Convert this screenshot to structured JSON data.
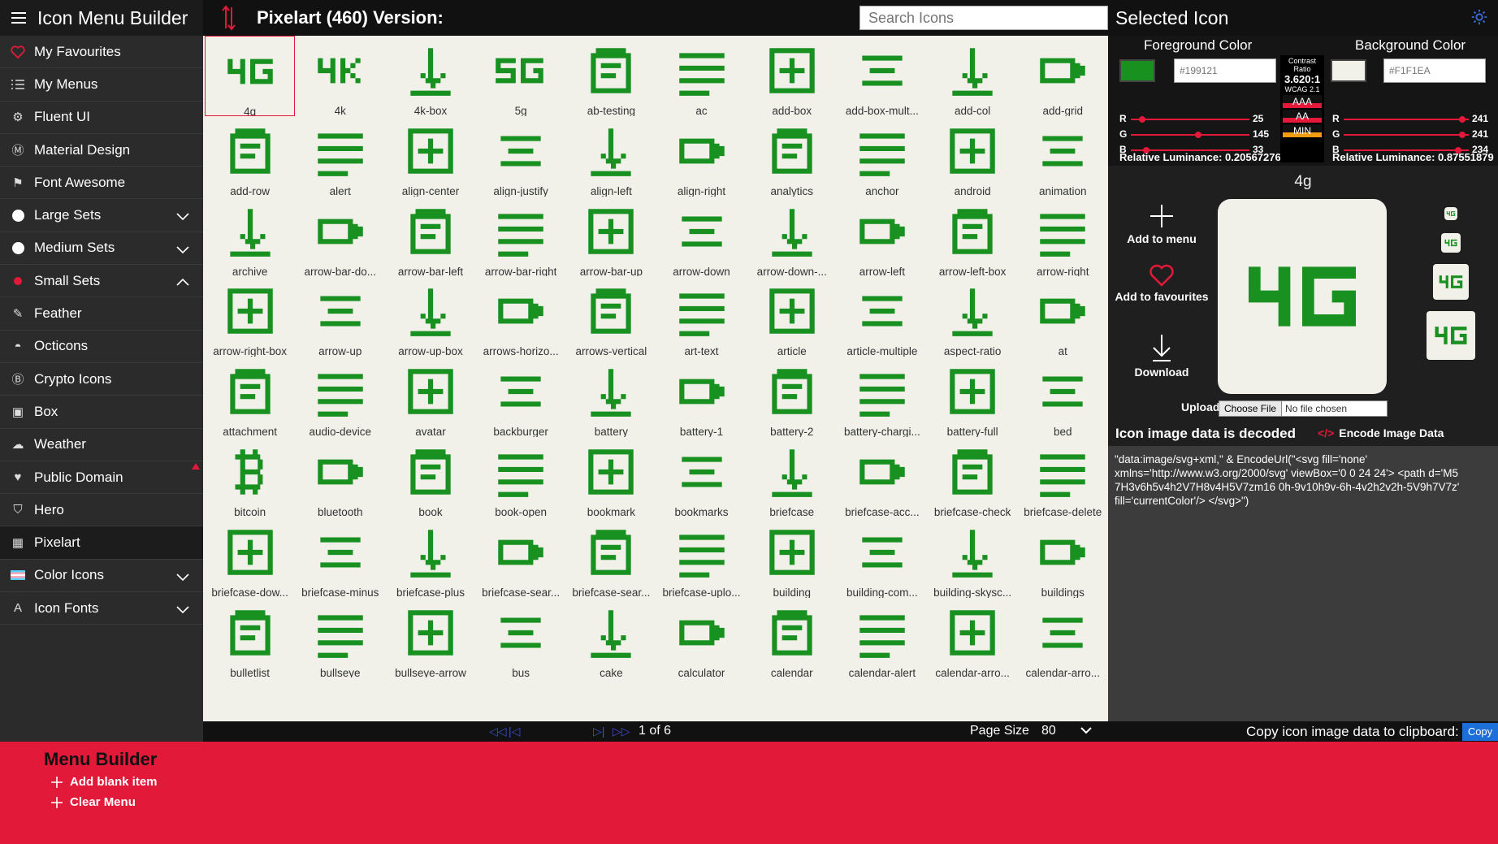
{
  "app": {
    "title": "Icon Menu Builder"
  },
  "sidebar": {
    "items": [
      {
        "label": "My Favourites",
        "icon": "heart-icon"
      },
      {
        "label": "My Menus",
        "icon": "list-icon"
      },
      {
        "label": "Fluent UI",
        "icon": "fluent-icon"
      },
      {
        "label": "Material Design",
        "icon": "material-icon"
      },
      {
        "label": "Font Awesome",
        "icon": "flag-icon"
      },
      {
        "label": "Large Sets",
        "icon": "white-dot-icon",
        "expand": "down"
      },
      {
        "label": "Medium Sets",
        "icon": "white-dot-icon",
        "expand": "down"
      },
      {
        "label": "Small Sets",
        "icon": "red-dot-icon",
        "expand": "up"
      },
      {
        "label": "Feather",
        "icon": "feather-icon"
      },
      {
        "label": "Octicons",
        "icon": "octocat-icon"
      },
      {
        "label": "Crypto Icons",
        "icon": "bitcoin-icon"
      },
      {
        "label": "Box",
        "icon": "box-icon"
      },
      {
        "label": "Weather",
        "icon": "weather-icon"
      },
      {
        "label": "Public Domain",
        "icon": "heart-pulse-icon"
      },
      {
        "label": "Hero",
        "icon": "shield-icon"
      },
      {
        "label": "Pixelart",
        "icon": "pixel-icon",
        "active": true
      },
      {
        "label": "Color Icons",
        "icon": "flag-color-icon",
        "expand": "down"
      },
      {
        "label": "Icon Fonts",
        "icon": "font-icon",
        "expand": "down"
      }
    ]
  },
  "center": {
    "title": "Pixelart (460) Version:",
    "search_placeholder": "Search Icons",
    "icons": [
      "4g",
      "4k",
      "4k-box",
      "5g",
      "ab-testing",
      "ac",
      "add-box",
      "add-box-mult...",
      "add-col",
      "add-grid",
      "add-row",
      "alert",
      "align-center",
      "align-justify",
      "align-left",
      "align-right",
      "analytics",
      "anchor",
      "android",
      "animation",
      "archive",
      "arrow-bar-do...",
      "arrow-bar-left",
      "arrow-bar-right",
      "arrow-bar-up",
      "arrow-down",
      "arrow-down-...",
      "arrow-left",
      "arrow-left-box",
      "arrow-right",
      "arrow-right-box",
      "arrow-up",
      "arrow-up-box",
      "arrows-horizo...",
      "arrows-vertical",
      "art-text",
      "article",
      "article-multiple",
      "aspect-ratio",
      "at",
      "attachment",
      "audio-device",
      "avatar",
      "backburger",
      "battery",
      "battery-1",
      "battery-2",
      "battery-chargi...",
      "battery-full",
      "bed",
      "bitcoin",
      "bluetooth",
      "book",
      "book-open",
      "bookmark",
      "bookmarks",
      "briefcase",
      "briefcase-acc...",
      "briefcase-check",
      "briefcase-delete",
      "briefcase-dow...",
      "briefcase-minus",
      "briefcase-plus",
      "briefcase-sear...",
      "briefcase-sear...",
      "briefcase-uplo...",
      "building",
      "building-com...",
      "building-skysc...",
      "buildings",
      "bulletlist",
      "bullseye",
      "bullseye-arrow",
      "bus",
      "cake",
      "calculator",
      "calendar",
      "calendar-alert",
      "calendar-arro...",
      "calendar-arro..."
    ],
    "pager": {
      "page": "1 of 6",
      "size_label": "Page Size",
      "size_value": "80"
    }
  },
  "right": {
    "title": "Selected Icon",
    "fg": {
      "title": "Foreground Color",
      "hex": "#199121",
      "r": "25",
      "g": "145",
      "b": "33",
      "r_frac": 0.098,
      "g_frac": 0.569,
      "b_frac": 0.129,
      "lum": "Relative Luminance: 0.20567276",
      "color": "#199121"
    },
    "bg": {
      "title": "Background Color",
      "hex": "#F1F1EA",
      "r": "241",
      "g": "241",
      "b": "234",
      "r_frac": 0.945,
      "g_frac": 0.945,
      "b_frac": 0.918,
      "lum": "Relative Luminance: 0.87551879",
      "color": "#F1F1EA"
    },
    "contrast": {
      "label": "Contrast Ratio",
      "ratio": "3.620:1",
      "wcag": "WCAG 2.1",
      "aaa": "AAA",
      "aa": "AA",
      "min": "MIN"
    },
    "selected_name": "4g",
    "actions": {
      "add_menu": "Add to menu",
      "add_fav": "Add to favourites",
      "download": "Download"
    },
    "upload_label": "Upload:",
    "file_button": "Choose File",
    "file_none": "No file chosen",
    "decoded": "Icon image data is decoded",
    "encode": "Encode Image Data",
    "data": "\"data:image/svg+xml,\" & EncodeUrl(\"<svg fill='none' xmlns='http://www.w3.org/2000/svg' viewBox='0 0 24 24'>     <path d='M5 7H3v6h5v4h2V7H8v4H5V7zm16 0h-9v10h9v-6h-4v2h2v2h-5V9h7V7z' fill='currentColor'/> </svg>\")",
    "copy_label": "Copy icon image data to clipboard:",
    "copy_button": "Copy"
  },
  "bottom": {
    "title": "Menu Builder",
    "add_blank": "Add blank item",
    "clear": "Clear Menu"
  },
  "colors": {
    "accent": "#e3193a",
    "icon_green": "#199121",
    "bg_cream": "#f1f1ea"
  }
}
